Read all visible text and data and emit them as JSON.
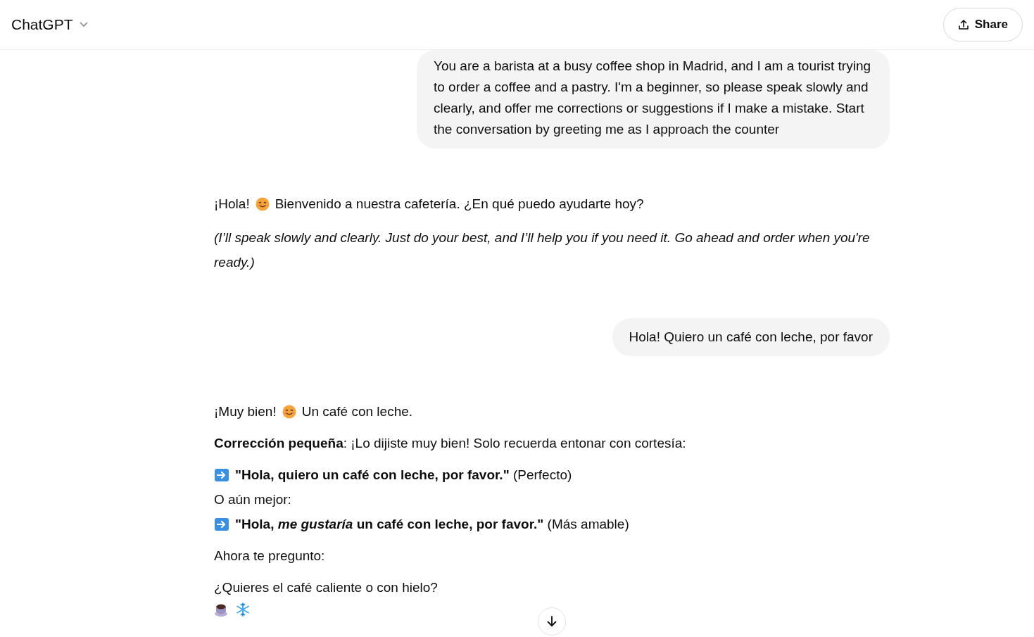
{
  "header": {
    "title": "ChatGPT",
    "share_label": "Share"
  },
  "messages": [
    {
      "kind": "user",
      "text": "You are a barista at a busy coffee shop in Madrid, and I am a tourist trying to order a coffee and a pastry. I'm a beginner, so please speak slowly and clearly, and offer me corrections or suggestions if I make a mistake. Start the conversation by greeting me as I approach the counter"
    },
    {
      "kind": "assistant",
      "paragraphs": [
        {
          "lines": [
            [
              {
                "kind": "text",
                "text": "¡Hola!"
              },
              {
                "kind": "smiley"
              },
              {
                "kind": "text",
                "text": "Bienvenido a nuestra cafetería. ¿En qué puedo ayudarte hoy?"
              }
            ]
          ]
        },
        {
          "kind": "note",
          "lines": [
            [
              {
                "kind": "text",
                "text": "(I’ll speak slowly and clearly. Just do your best, and I’ll help you if you need it. Go ahead and order when you're ready.)"
              }
            ]
          ]
        }
      ]
    },
    {
      "kind": "user",
      "text": "Hola! Quiero un café con leche, por favor"
    },
    {
      "kind": "assistant",
      "paragraphs": [
        {
          "lines": [
            [
              {
                "kind": "text",
                "text": "¡Muy bien!"
              },
              {
                "kind": "smiley"
              },
              {
                "kind": "text",
                "text": "Un café con leche."
              }
            ]
          ]
        },
        {
          "lines": [
            [
              {
                "kind": "text",
                "text": "**Corrección pequeña**: ¡Lo dijiste muy bien! Solo recuerda entonar con cortesía:"
              }
            ]
          ]
        },
        {
          "lines": [
            [
              {
                "kind": "arrow"
              },
              {
                "kind": "text",
                "text": "**\"Hola, quiero un café con leche, por favor.\"** (Perfecto)"
              }
            ],
            [
              {
                "kind": "text",
                "text": "O aún mejor:"
              }
            ],
            [
              {
                "kind": "arrow"
              },
              {
                "kind": "text",
                "text": "**\"Hola, *me gustaría* un café con leche, por favor.\"** (Más amable)"
              }
            ]
          ]
        },
        {
          "lines": [
            [
              {
                "kind": "text",
                "text": "Ahora te pregunto:"
              }
            ]
          ]
        },
        {
          "lines": [
            [
              {
                "kind": "text",
                "text": "¿Quieres el café caliente o con hielo?"
              }
            ],
            [
              {
                "kind": "cup"
              },
              {
                "kind": "snowflake"
              }
            ]
          ]
        }
      ]
    }
  ]
}
